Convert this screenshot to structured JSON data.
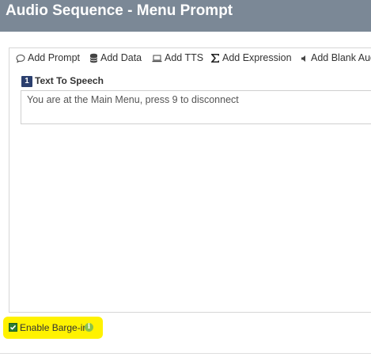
{
  "window": {
    "title": "Audio Sequence - Menu Prompt"
  },
  "toolbar": {
    "items": [
      {
        "label": "Add Prompt",
        "icon": "comment-icon"
      },
      {
        "label": "Add Data",
        "icon": "database-icon"
      },
      {
        "label": "Add TTS",
        "icon": "laptop-icon"
      },
      {
        "label": "Add Expression",
        "icon": "sigma-icon"
      },
      {
        "label": "Add Blank Aud",
        "icon": "volume-icon"
      }
    ]
  },
  "sequence": {
    "blocks": [
      {
        "number": "1",
        "title": "Text To Speech",
        "text": "You are at the Main Menu, press 9 to disconnect"
      }
    ]
  },
  "options": {
    "barge_in_label": "Enable Barge-in",
    "barge_in_checked": true,
    "info_glyph": "i"
  },
  "colors": {
    "titlebar": "#7b8896",
    "block_badge": "#2b3f6e",
    "highlight": "#fff200",
    "checkbox": "#2e7d32",
    "info": "#8bc34a"
  }
}
